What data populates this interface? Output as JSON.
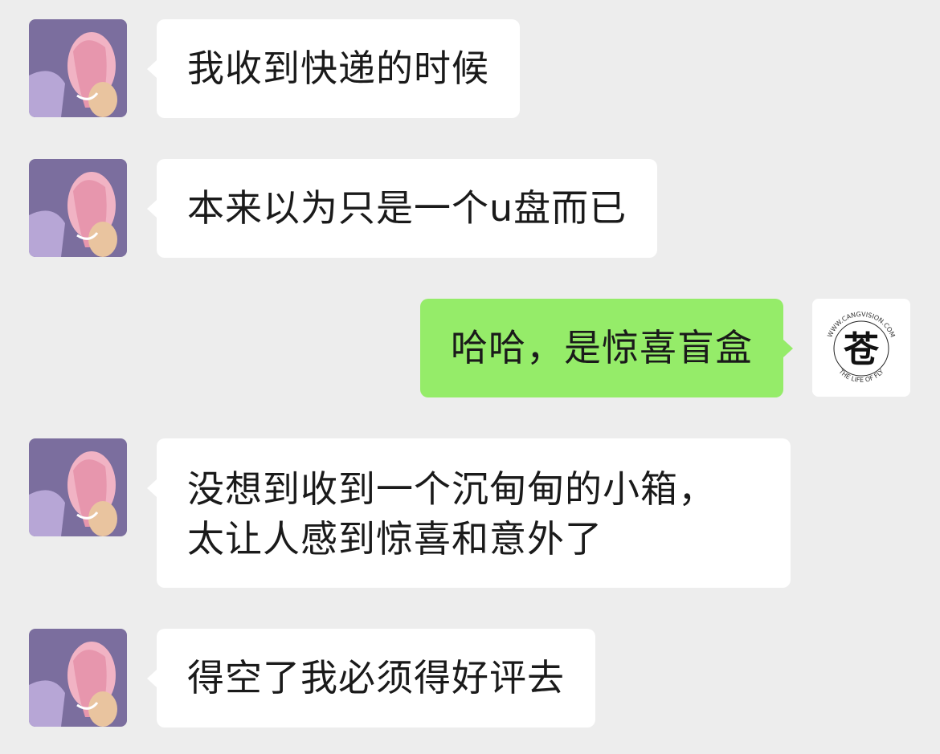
{
  "chat": {
    "messages": [
      {
        "direction": "incoming",
        "lines": [
          "我收到快递的时候"
        ]
      },
      {
        "direction": "incoming",
        "lines": [
          "本来以为只是一个u盘而已"
        ]
      },
      {
        "direction": "outgoing",
        "lines": [
          "哈哈，是惊喜盲盒"
        ]
      },
      {
        "direction": "incoming",
        "lines": [
          "没想到收到一个沉甸甸的小箱，",
          "太让人感到惊喜和意外了"
        ]
      },
      {
        "direction": "incoming",
        "lines": [
          "得空了我必须得好评去"
        ]
      }
    ],
    "self_avatar": {
      "logo_arc_top": "WWW.CANGVISION.COM",
      "logo_arc_bottom": "THE LIFE OF FLY",
      "logo_character": "苍"
    }
  },
  "colors": {
    "background": "#ededed",
    "incoming_bubble": "#ffffff",
    "outgoing_bubble": "#95ec69"
  }
}
